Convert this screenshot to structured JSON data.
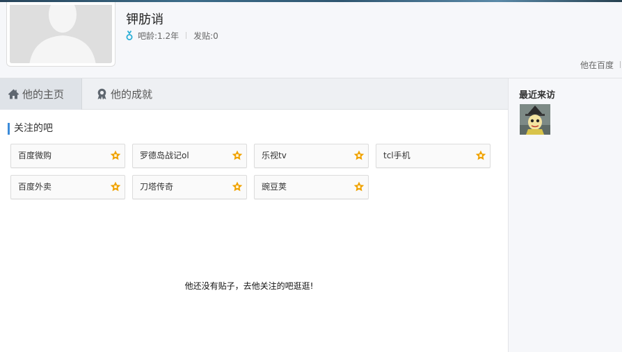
{
  "profile": {
    "username": "钾肪诮",
    "age_label": "吧龄:1.2年",
    "posts_label": "发贴:0",
    "elsewhere_label": "他在百度"
  },
  "tabs": [
    {
      "label": "他的主页",
      "icon": "home-icon",
      "active": true
    },
    {
      "label": "他的成就",
      "icon": "medal-icon",
      "active": false
    }
  ],
  "followed": {
    "title": "关注的吧",
    "items": [
      "百度微购",
      "罗德岛战记ol",
      "乐视tv",
      "tcl手机",
      "百度外卖",
      "刀塔传奇",
      "豌豆荚"
    ]
  },
  "visitors": {
    "title": "最近来访"
  },
  "empty_message": "他还没有贴子，去他关注的吧逛逛!",
  "colors": {
    "accent": "#3b8bd9",
    "star": "#f0a200",
    "gender": "#2aaed6"
  }
}
